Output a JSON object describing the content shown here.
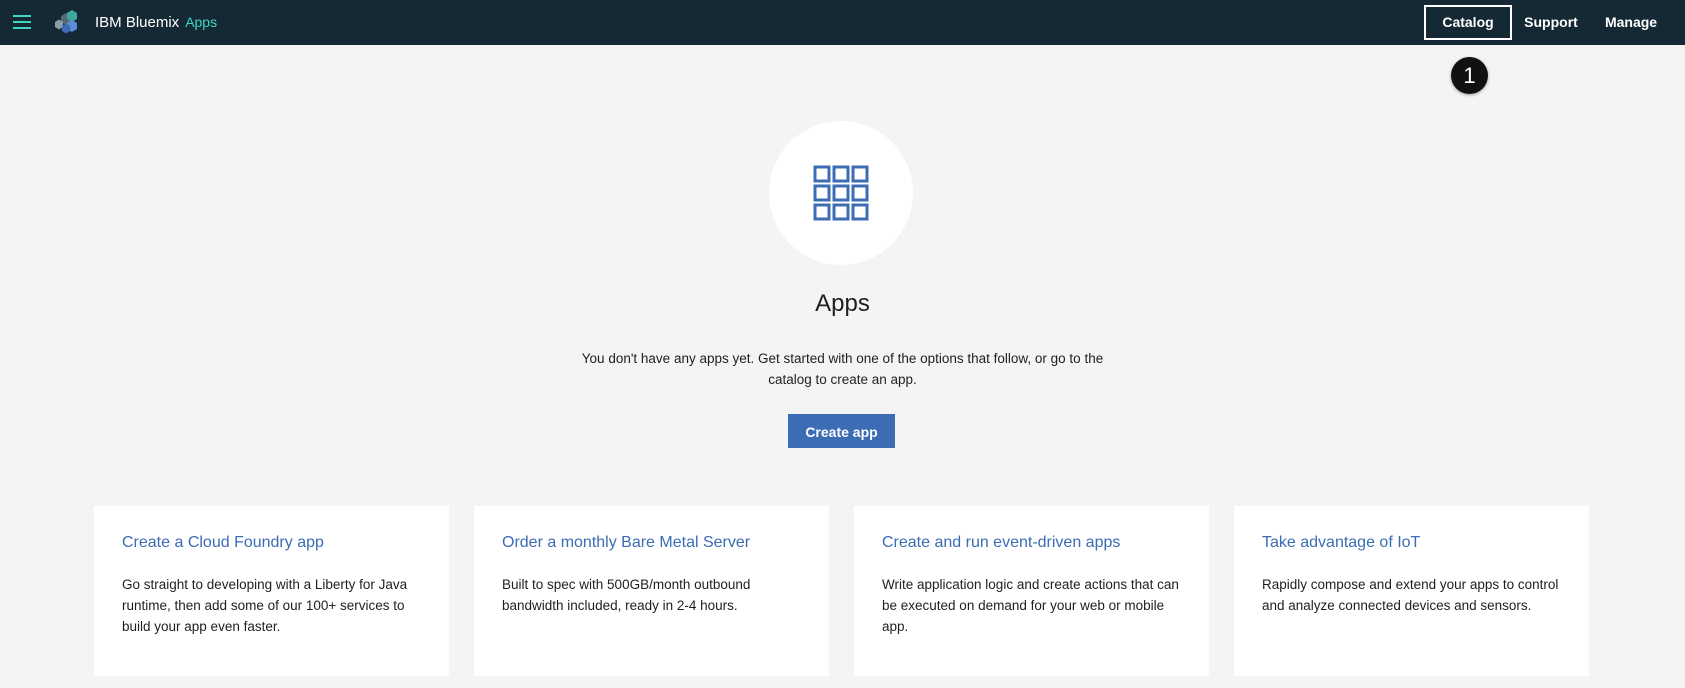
{
  "header": {
    "brand": "IBM Bluemix",
    "section": "Apps",
    "nav": [
      {
        "label": "Catalog"
      },
      {
        "label": "Support"
      },
      {
        "label": "Manage"
      }
    ],
    "accent_color": "#41d6c3",
    "background_color": "#152935"
  },
  "callout": {
    "number": "1"
  },
  "hero": {
    "icon": "apps-grid-icon",
    "title": "Apps",
    "description": "You don't have any apps yet. Get started with one of the options that follow, or go to the catalog to create an app.",
    "button_label": "Create app",
    "button_color": "#3b6cb4"
  },
  "cards": [
    {
      "title": "Create a Cloud Foundry app",
      "description": "Go straight to developing with a Liberty for Java runtime, then add some of our 100+ services to build your app even faster."
    },
    {
      "title": "Order a monthly Bare Metal Server",
      "description": "Built to spec with 500GB/month outbound bandwidth included, ready in 2-4 hours."
    },
    {
      "title": "Create and run event-driven apps",
      "description": "Write application logic and create actions that can be executed on demand for your web or mobile app."
    },
    {
      "title": "Take advantage of IoT",
      "description": "Rapidly compose and extend your apps to control and analyze connected devices and sensors."
    }
  ]
}
